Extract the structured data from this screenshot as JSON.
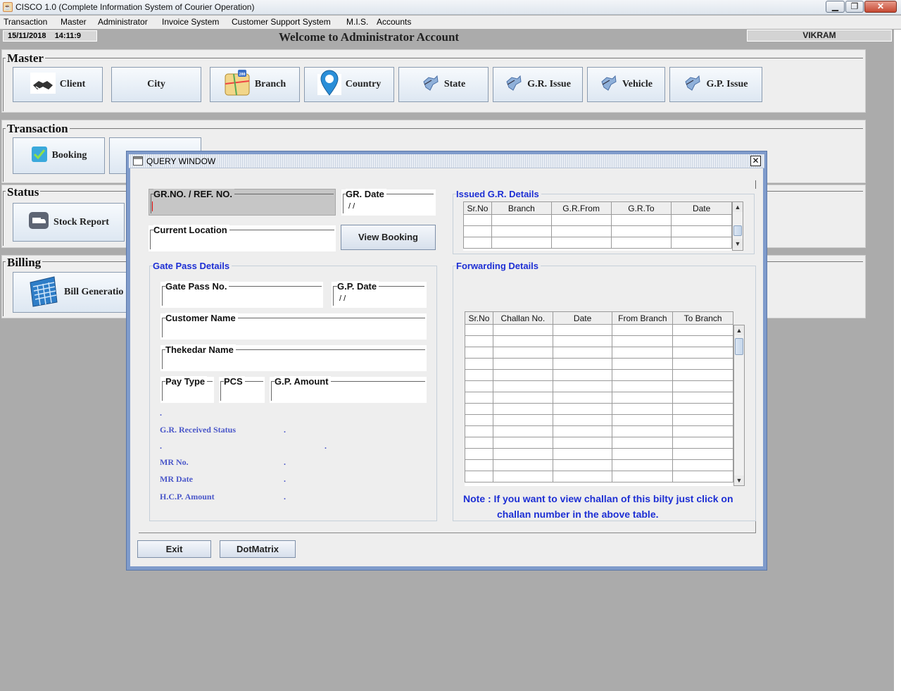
{
  "window": {
    "title": "CISCO 1.0 (Complete Information System of Courier Operation)"
  },
  "menu": [
    "Transaction",
    "Master",
    "Administrator",
    "Invoice System",
    "Customer Support System",
    "M.I.S.",
    "Accounts"
  ],
  "status": {
    "date": "15/11/2018",
    "time": "14:11:9",
    "welcome": "Welcome to Administrator Account",
    "user": "VIKRAM"
  },
  "master": {
    "title": "Master",
    "buttons": [
      "Client",
      "City",
      "Branch",
      "Country",
      "State",
      "G.R. Issue",
      "Vehicle",
      "G.P. Issue"
    ]
  },
  "transaction": {
    "title": "Transaction",
    "buttons": [
      "Booking"
    ]
  },
  "status_section": {
    "title": "Status",
    "buttons": [
      "Stock Report"
    ]
  },
  "billing": {
    "title": "Billing",
    "buttons": [
      "Bill Generatio"
    ]
  },
  "dialog": {
    "title": "QUERY WINDOW",
    "gr_no_label": "GR.NO. / REF. NO.",
    "gr_date_label": "GR. Date",
    "gr_date_value": "/ /",
    "current_location_label": "Current Location",
    "view_booking": "View Booking",
    "gate_pass": {
      "title": "Gate Pass Details",
      "gp_no_label": "Gate Pass No.",
      "gp_date_label": "G.P. Date",
      "gp_date_value": "/ /",
      "customer_label": "Customer Name",
      "thekedar_label": "Thekedar Name",
      "pay_type_label": "Pay Type",
      "pcs_label": "PCS",
      "gp_amount_label": "G.P. Amount",
      "dot": ".",
      "gr_received_label": "G.R. Received Status",
      "mr_no_label": "MR No.",
      "mr_date_label": "MR Date",
      "hcp_amount_label": "H.C.P. Amount"
    },
    "issued_gr": {
      "title": "Issued G.R. Details",
      "columns": [
        "Sr.No",
        "Branch",
        "G.R.From",
        "G.R.To",
        "Date"
      ]
    },
    "forwarding": {
      "title": "Forwarding Details",
      "columns": [
        "Sr.No",
        "Challan No.",
        "Date",
        "From Branch",
        "To Branch"
      ],
      "note_line1": "Note : If you want to view challan of this bilty just click on",
      "note_line2": "challan number in the above table."
    },
    "exit": "Exit",
    "dotmatrix": "DotMatrix"
  }
}
